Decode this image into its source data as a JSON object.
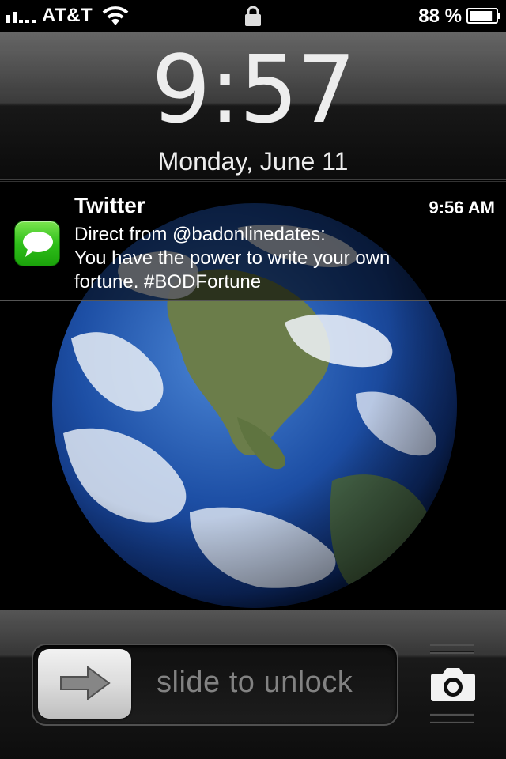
{
  "status_bar": {
    "carrier": "AT&T",
    "battery_percent": "88 %",
    "battery_level": 0.88,
    "signal_bars": 2,
    "icons": [
      "signal-icon",
      "wifi-icon",
      "lock-icon",
      "battery-icon"
    ]
  },
  "lock_screen": {
    "time": "9:57",
    "date": "Monday, June 11"
  },
  "notification": {
    "app_name": "Twitter",
    "time": "9:56 AM",
    "line1": "Direct from @badonlinedates:",
    "line2": "You have the power to write your own",
    "line3": "fortune. #BODFortune",
    "icon": "messages-icon"
  },
  "unlock": {
    "label": "slide to unlock",
    "knob_icon": "arrow-right-icon",
    "camera_icon": "camera-icon"
  },
  "colors": {
    "messages_green": "#2fbf1a",
    "slider_text": "#8a8a8a"
  }
}
